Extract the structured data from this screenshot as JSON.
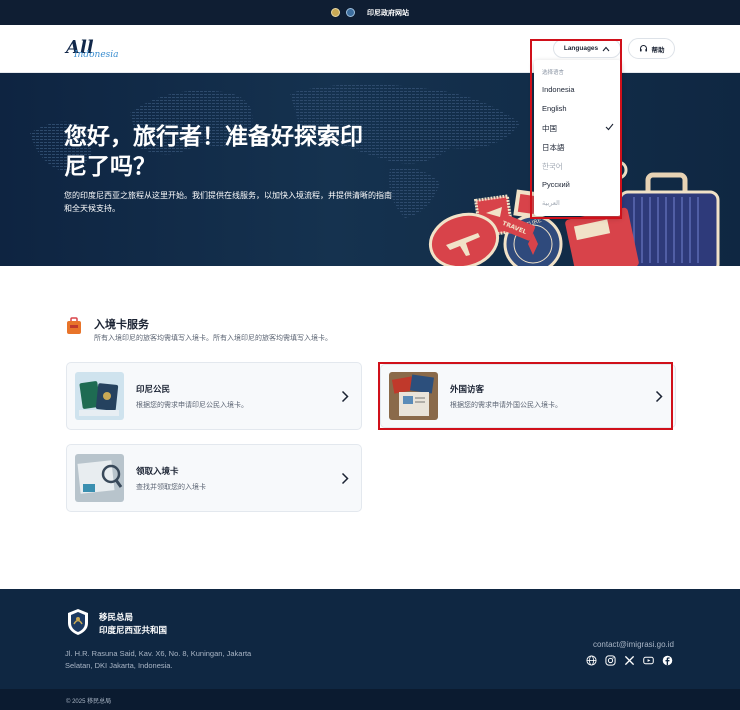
{
  "gov_bar": {
    "text": "印尼政府网站"
  },
  "header": {
    "logo_main": "All",
    "logo_sub": "Indonesia",
    "language_button": "Languages",
    "help_button": "帮助"
  },
  "language_menu": {
    "heading": "选择语言",
    "options": [
      {
        "label": "Indonesia",
        "selected": false
      },
      {
        "label": "English",
        "selected": false
      },
      {
        "label": "中国",
        "selected": true
      },
      {
        "label": "日本語",
        "selected": false
      },
      {
        "label": "한국어",
        "selected": false
      },
      {
        "label": "Русский",
        "selected": false
      },
      {
        "label": "العربية",
        "selected": false
      }
    ]
  },
  "hero": {
    "title": "您好，旅行者！准备好探索印尼了吗？",
    "subtitle": "您的印度尼西亚之旅程从这里开始。我们提供在线服务，以加快入境流程，并提供清晰的指南和全天候支持。",
    "stamp_text_1": "TRAVEL",
    "stamp_text_2": "ADVENTURE"
  },
  "section": {
    "title": "入境卡服务",
    "description": "所有入境印尼的旅客均需填写入境卡。所有入境印尼的旅客均需填写入境卡。"
  },
  "cards": [
    {
      "title": "印尼公民",
      "description": "根据您的需求申请印尼公民入境卡。"
    },
    {
      "title": "外国访客",
      "description": "根据您的需求申请外国公民入境卡。"
    },
    {
      "title": "领取入境卡",
      "description": "查找并领取您的入境卡"
    }
  ],
  "footer": {
    "org_line1": "移民总局",
    "org_line2": "印度尼西亚共和国",
    "address": "Jl. H.R. Rasuna Said, Kav. X6, No. 8, Kuningan, Jakarta Selatan, DKI Jakarta, Indonesia.",
    "email": "contact@imigrasi.go.id",
    "socials": [
      "globe-icon",
      "instagram-icon",
      "x-icon",
      "youtube-icon",
      "facebook-icon"
    ],
    "copyright": "© 2025 移民总局"
  },
  "colors": {
    "navy": "#0f2742",
    "highlight_red": "#d0101a",
    "stamp_red": "#d8434a"
  }
}
